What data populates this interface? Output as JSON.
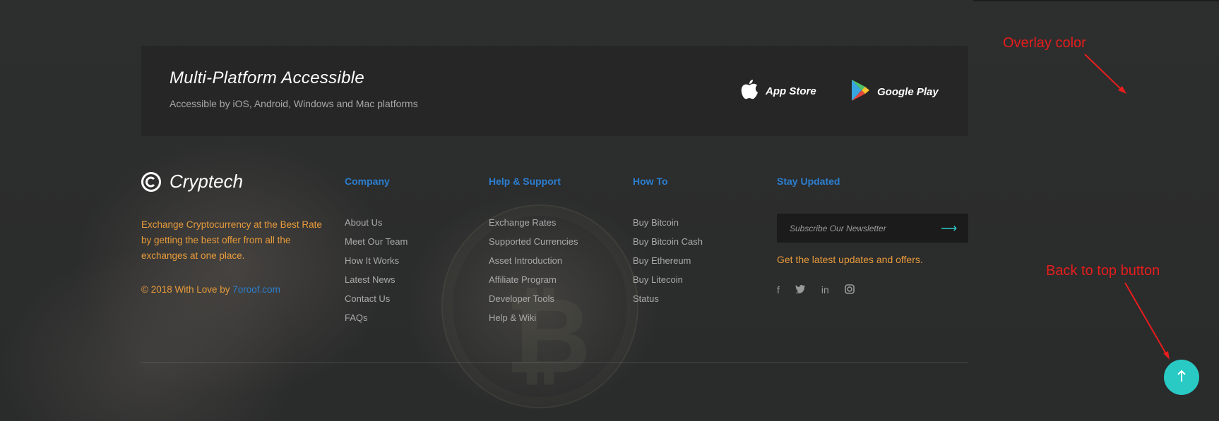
{
  "banner": {
    "title": "Multi-Platform Accessible",
    "subtitle": "Accessible by iOS, Android, Windows and Mac platforms",
    "app_store": "App Store",
    "google_play": "Google Play"
  },
  "brand": {
    "name": "Cryptech",
    "description": "Exchange Cryptocurrency at the Best Rate by getting the best offer from all the exchanges at one place.",
    "copyright_prefix": "© 2018 With Love by",
    "copyright_link": "7oroof.com"
  },
  "columns": [
    {
      "title": "Company",
      "items": [
        "About Us",
        "Meet Our Team",
        "How It Works",
        "Latest News",
        "Contact Us",
        "FAQs"
      ]
    },
    {
      "title": "Help & Support",
      "items": [
        "Exchange Rates",
        "Supported Currencies",
        "Asset Introduction",
        "Affiliate Program",
        "Developer Tools",
        "Help & Wiki"
      ]
    },
    {
      "title": "How To",
      "items": [
        "Buy Bitcoin",
        "Buy Bitcoin Cash",
        "Buy Ethereum",
        "Buy Litecoin",
        "Status"
      ]
    }
  ],
  "newsletter": {
    "title": "Stay Updated",
    "placeholder": "Subscribe Our Newsletter",
    "note": "Get the latest updates and offers."
  },
  "socials": [
    "facebook-icon",
    "twitter-icon",
    "linkedin-icon",
    "instagram-icon"
  ],
  "annotations": {
    "overlay": "Overlay color",
    "back_to_top": "Back to top button"
  },
  "colors": {
    "accent_orange": "#e89b3b",
    "accent_blue": "#2b7fd1",
    "back_to_top": "#29c9c4",
    "annotation": "#e81d1d"
  }
}
